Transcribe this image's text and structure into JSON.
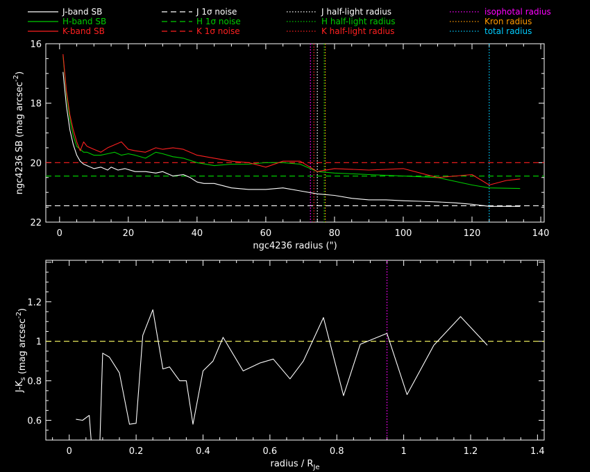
{
  "colors": {
    "background": "#000000",
    "axis": "#ffffff",
    "J": "#ffffff",
    "H": "#00cc00",
    "K": "#ff2020",
    "isophotal": "#ff00ff",
    "kron": "#ff9900",
    "total": "#00ccff"
  },
  "legend": [
    {
      "label": "J-band SB",
      "color": "#ffffff",
      "style": "solid"
    },
    {
      "label": "H-band SB",
      "color": "#00cc00",
      "style": "solid"
    },
    {
      "label": "K-band SB",
      "color": "#ff2020",
      "style": "solid"
    },
    {
      "label": "J 1σ noise",
      "color": "#ffffff",
      "style": "dashed"
    },
    {
      "label": "H 1σ noise",
      "color": "#00cc00",
      "style": "dashed"
    },
    {
      "label": "K 1σ noise",
      "color": "#ff2020",
      "style": "dashed"
    },
    {
      "label": "J half-light radius",
      "color": "#ffffff",
      "style": "dotted"
    },
    {
      "label": "H half-light radius",
      "color": "#00cc00",
      "style": "dotted"
    },
    {
      "label": "K half-light radius",
      "color": "#ff2020",
      "style": "dotted"
    },
    {
      "label": "isophotal radius",
      "color": "#ff00ff",
      "style": "dotted"
    },
    {
      "label": "Kron radius",
      "color": "#ff9900",
      "style": "dotted"
    },
    {
      "label": "total radius",
      "color": "#00ccff",
      "style": "dotted"
    }
  ],
  "chart_data": [
    {
      "type": "line",
      "xlabel": "ngc4236 radius (\")",
      "ylabel": "ngc4236 SB (mag arcsec",
      "ylabel_sup": "-2",
      "ylabel_tail": ")",
      "xlim": [
        -4,
        141
      ],
      "ylim": [
        16,
        22
      ],
      "y_inverted": true,
      "xticks": [
        0,
        20,
        40,
        60,
        80,
        100,
        120,
        140
      ],
      "yticks": [
        16,
        18,
        20,
        22
      ],
      "series": [
        {
          "name": "J-band SB",
          "color": "#ffffff",
          "x": [
            1,
            2,
            3,
            4,
            5,
            6,
            7,
            8,
            10,
            12,
            14,
            15,
            17,
            19,
            22,
            25,
            28,
            30,
            33,
            36,
            38,
            40,
            42,
            45,
            50,
            55,
            60,
            65,
            70,
            75,
            80,
            85,
            90,
            95,
            100,
            105,
            110,
            115,
            120,
            125,
            130,
            134
          ],
          "y": [
            16.95,
            18.1,
            18.9,
            19.4,
            19.75,
            19.95,
            20.05,
            20.1,
            20.2,
            20.15,
            20.25,
            20.15,
            20.25,
            20.2,
            20.3,
            20.3,
            20.35,
            20.3,
            20.45,
            20.4,
            20.5,
            20.65,
            20.7,
            20.7,
            20.85,
            20.9,
            20.9,
            20.85,
            20.95,
            21.05,
            21.1,
            21.2,
            21.25,
            21.25,
            21.28,
            21.3,
            21.32,
            21.35,
            21.4,
            21.47,
            21.47,
            21.47
          ]
        },
        {
          "name": "H-band SB",
          "color": "#00cc00",
          "x": [
            1,
            2,
            3,
            4,
            5,
            6,
            7,
            8,
            10,
            12,
            14,
            16,
            18,
            20,
            22,
            25,
            28,
            30,
            33,
            36,
            40,
            45,
            50,
            55,
            60,
            65,
            70,
            75,
            80,
            90,
            100,
            110,
            120,
            125,
            134
          ],
          "y": [
            16.4,
            17.7,
            18.55,
            19.1,
            19.45,
            19.55,
            19.65,
            19.65,
            19.75,
            19.75,
            19.7,
            19.65,
            19.75,
            19.7,
            19.75,
            19.85,
            19.65,
            19.7,
            19.8,
            19.85,
            20.0,
            20.1,
            20.05,
            20.05,
            20.0,
            20.0,
            20.05,
            20.3,
            20.35,
            20.4,
            20.45,
            20.5,
            20.75,
            20.85,
            20.87
          ]
        },
        {
          "name": "K-band SB",
          "color": "#ff2020",
          "x": [
            1,
            2,
            3,
            4,
            5,
            6,
            7,
            8,
            10,
            12,
            14,
            16,
            18,
            20,
            22,
            25,
            28,
            30,
            33,
            36,
            40,
            45,
            50,
            55,
            60,
            65,
            70,
            75,
            80,
            90,
            100,
            110,
            120,
            125,
            130,
            134
          ],
          "y": [
            16.35,
            17.6,
            18.4,
            18.9,
            19.3,
            19.6,
            19.3,
            19.45,
            19.55,
            19.65,
            19.5,
            19.4,
            19.3,
            19.55,
            19.6,
            19.65,
            19.5,
            19.55,
            19.5,
            19.55,
            19.75,
            19.85,
            19.95,
            20.0,
            20.15,
            19.95,
            19.95,
            20.3,
            20.2,
            20.25,
            20.2,
            20.5,
            20.4,
            20.75,
            20.6,
            20.55
          ]
        }
      ],
      "hlines": [
        {
          "name": "J 1σ noise",
          "y": 21.45,
          "color": "#ffffff",
          "style": "dashed"
        },
        {
          "name": "H 1σ noise",
          "y": 20.45,
          "color": "#00cc00",
          "style": "dashed"
        },
        {
          "name": "K 1σ noise",
          "y": 20.0,
          "color": "#ff2020",
          "style": "dashed"
        }
      ],
      "vlines": [
        {
          "name": "J half-light radius",
          "x": 75,
          "color": "#ffffff",
          "style": "dotted"
        },
        {
          "name": "H half-light radius",
          "x": 77,
          "color": "#00cc00",
          "style": "dotted"
        },
        {
          "name": "K half-light radius",
          "x": 74,
          "color": "#ff2020",
          "style": "dotted"
        },
        {
          "name": "isophotal radius",
          "x": 73,
          "color": "#ff00ff",
          "style": "dotted"
        },
        {
          "name": "Kron radius",
          "x": 77.3,
          "color": "#ff9900",
          "style": "dotted"
        },
        {
          "name": "total radius",
          "x": 125,
          "color": "#00ccff",
          "style": "dotted"
        }
      ]
    },
    {
      "type": "line",
      "xlabel": "radius / R",
      "xlabel_sub": "Je",
      "ylabel": "J-K",
      "ylabel_sub": "s",
      "ylabel_tail": " (mag arcsec",
      "ylabel_sup": "-2",
      "ylabel_tail2": ")",
      "xlim": [
        -0.07,
        1.42
      ],
      "ylim": [
        0.5,
        1.41
      ],
      "xticks": [
        0,
        0.2,
        0.4,
        0.6,
        0.8,
        1,
        1.2,
        1.4
      ],
      "yticks": [
        0.6,
        0.8,
        1,
        1.2
      ],
      "series": [
        {
          "name": "J-Ks",
          "color": "#ffffff",
          "x": [
            0.02,
            0.04,
            0.06,
            0.07,
            0.08,
            0.09,
            0.1,
            0.12,
            0.15,
            0.18,
            0.2,
            0.22,
            0.25,
            0.28,
            0.3,
            0.33,
            0.35,
            0.37,
            0.4,
            0.43,
            0.46,
            0.52,
            0.57,
            0.61,
            0.66,
            0.7,
            0.76,
            0.82,
            0.87,
            0.95,
            1.01,
            1.09,
            1.17,
            1.25
          ],
          "y": [
            0.605,
            0.6,
            0.625,
            0.4,
            0.4,
            0.4,
            0.94,
            0.92,
            0.84,
            0.58,
            0.585,
            1.03,
            1.16,
            0.86,
            0.87,
            0.8,
            0.8,
            0.58,
            0.85,
            0.9,
            1.02,
            0.85,
            0.89,
            0.91,
            0.81,
            0.9,
            1.12,
            0.725,
            0.985,
            1.04,
            0.73,
            0.98,
            1.125,
            0.98
          ]
        }
      ],
      "hlines": [
        {
          "y": 1,
          "color": "#ffff66",
          "style": "dashed"
        }
      ],
      "vlines": [
        {
          "x": 0.95,
          "color": "#ff00ff",
          "style": "dotted"
        }
      ]
    }
  ]
}
